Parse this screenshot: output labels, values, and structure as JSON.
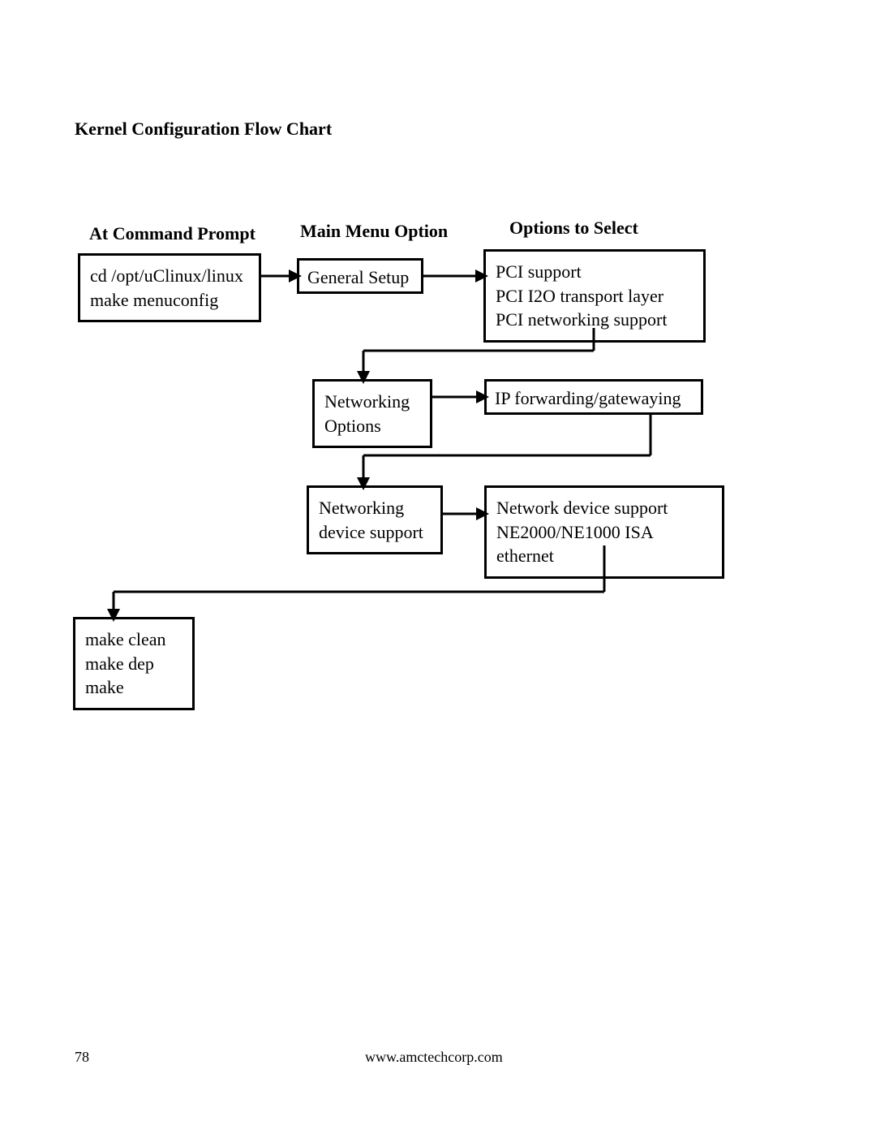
{
  "title": "Kernel Configuration Flow Chart",
  "columns": {
    "left": "At Command Prompt",
    "mid": "Main Menu Option",
    "right": "Options to Select"
  },
  "boxes": {
    "cmd": {
      "line1": "cd /opt/uClinux/linux",
      "line2": "make menuconfig"
    },
    "general_setup": "General Setup",
    "pci": {
      "line1": "PCI support",
      "line2": "PCI I2O transport layer",
      "line3": "PCI networking support"
    },
    "net_opts": {
      "line1": "Networking",
      "line2": "Options"
    },
    "ipfw": "IP forwarding/gatewaying",
    "net_dev": {
      "line1": "Networking",
      "line2": "device support"
    },
    "net_dev_opts": {
      "line1": "Network device support",
      "line2": "NE2000/NE1000 ISA ethernet"
    },
    "make_final": {
      "line1": "make clean",
      "line2": "make dep",
      "line3": "make"
    }
  },
  "footer": {
    "page": "78",
    "url": "www.amctechcorp.com"
  }
}
